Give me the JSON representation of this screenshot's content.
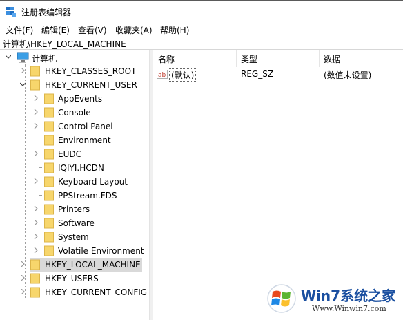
{
  "window": {
    "title": "注册表编辑器"
  },
  "menu": [
    "文件(F)",
    "编辑(E)",
    "查看(V)",
    "收藏夹(A)",
    "帮助(H)"
  ],
  "address": "计算机\\HKEY_LOCAL_MACHINE",
  "tree": {
    "root": "计算机",
    "hkeys": [
      "HKEY_CLASSES_ROOT",
      "HKEY_CURRENT_USER",
      "HKEY_LOCAL_MACHINE",
      "HKEY_USERS",
      "HKEY_CURRENT_CONFIG"
    ],
    "current_user_children": [
      "AppEvents",
      "Console",
      "Control Panel",
      "Environment",
      "EUDC",
      "IQIYI.HCDN",
      "Keyboard Layout",
      "PPStream.FDS",
      "Printers",
      "Software",
      "System",
      "Volatile Environment"
    ],
    "selected": "HKEY_LOCAL_MACHINE"
  },
  "list": {
    "headers": {
      "name": "名称",
      "type": "类型",
      "data": "数据"
    },
    "rows": [
      {
        "name": "(默认)",
        "type": "REG_SZ",
        "data": "(数值未设置)"
      }
    ]
  },
  "watermark": {
    "brand": "Win7系统之家",
    "url": "Www.Winwin7.com"
  },
  "colors": {
    "folder": "#f7d66c",
    "folder_dark": "#dcb54a",
    "selection": "#d9d9d9",
    "accent": "#0078d7"
  }
}
